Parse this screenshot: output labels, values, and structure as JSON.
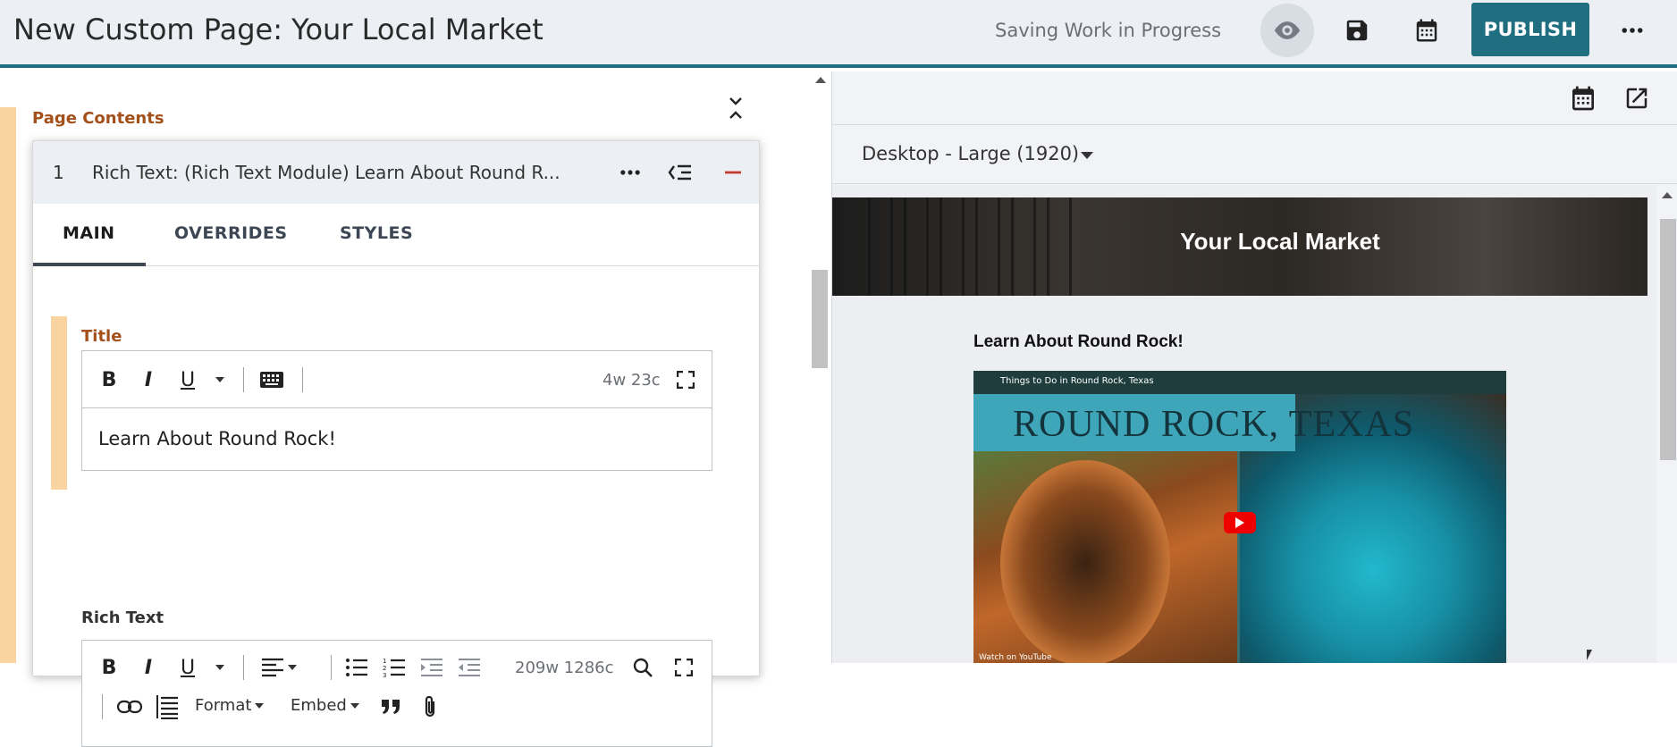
{
  "header": {
    "title": "New Custom Page: Your Local Market",
    "status": "Saving Work in Progress",
    "publish_label": "PUBLISH",
    "icons": [
      "eye-icon",
      "save-icon",
      "calendar-icon",
      "more-icon"
    ]
  },
  "editor": {
    "section_label": "Page Contents",
    "module": {
      "number": "1",
      "title": "Rich Text: (Rich Text Module) Learn About Round R...",
      "tabs": [
        {
          "label": "MAIN",
          "active": true
        },
        {
          "label": "OVERRIDES",
          "active": false
        },
        {
          "label": "STYLES",
          "active": false
        }
      ],
      "title_field": {
        "label": "Title",
        "counter": "4w 23c",
        "value": "Learn About Round Rock!",
        "toolbar": {
          "bold": "B",
          "italic": "I",
          "underline": "U"
        }
      },
      "rich_text_field": {
        "label": "Rich Text",
        "counter": "209w 1286c",
        "toolbar": {
          "bold": "B",
          "italic": "I",
          "underline": "U",
          "format": "Format",
          "embed": "Embed"
        }
      }
    }
  },
  "preview": {
    "device": "Desktop - Large (1920)",
    "hero_title": "Your Local Market",
    "heading": "Learn About Round Rock!",
    "video": {
      "channel_title": "Things to Do in Round Rock, Texas",
      "banner": "ROUND ROCK, TEXAS",
      "watch_on": "Watch on YouTube"
    }
  },
  "colors": {
    "accent": "#1f6f80",
    "field_accent": "#f9d3a0",
    "label_orange": "#a3501a",
    "header_bg": "#eceff4"
  }
}
